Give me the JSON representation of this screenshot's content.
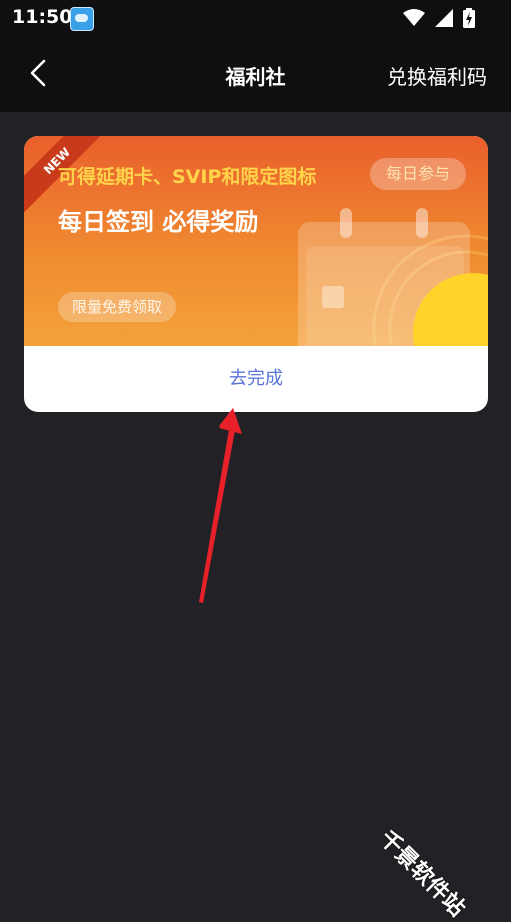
{
  "status_bar": {
    "time": "11:50"
  },
  "navbar": {
    "title": "福利社",
    "redeem_label": "兑换福利码"
  },
  "card": {
    "ribbon": "NEW",
    "subtitle": "可得延期卡、SVIP和限定图标",
    "join_button": "每日参与",
    "headline": "每日签到 必得奖励",
    "badge": "限量免费领取",
    "action_label": "去完成"
  },
  "watermark": "千景软件站",
  "colors": {
    "accent_text": "#5a74d8",
    "banner_start": "#e95f2c",
    "banner_end": "#f3a23a",
    "arrow": "#e8202a"
  }
}
